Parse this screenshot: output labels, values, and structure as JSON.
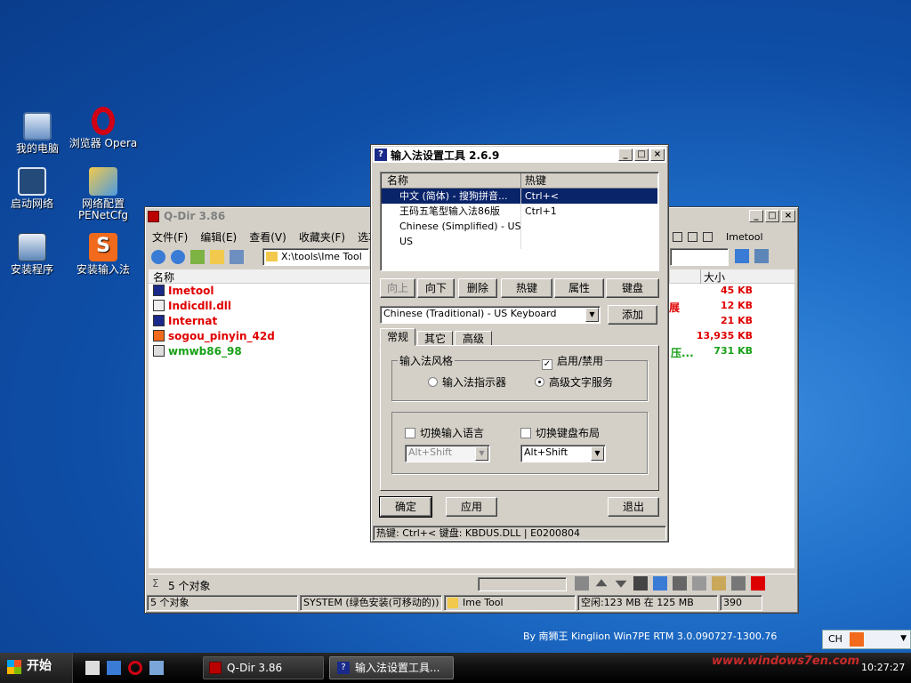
{
  "desktop": {
    "icons": [
      {
        "label": "我的电脑",
        "icon": "computer-icon"
      },
      {
        "label": "浏览器 Opera",
        "icon": "opera-icon"
      },
      {
        "label": "启动网络",
        "icon": "network-monitor-icon"
      },
      {
        "label": "网络配置",
        "sub": "PENetCfg",
        "icon": "network-config-icon"
      },
      {
        "label": "安装程序",
        "icon": "installer-icon"
      },
      {
        "label": "安装输入法",
        "icon": "sogou-icon"
      }
    ],
    "watermark": "By 南狮王 Kinglion Win7PE RTM 3.0.090727-1300.76"
  },
  "qdir": {
    "title": "Q-Dir 3.86",
    "menu": [
      "文件(F)",
      "编辑(E)",
      "查看(V)",
      "收藏夹(F)",
      "选项"
    ],
    "path": "X:\\tools\\Ime Tool",
    "right_label": "Imetool",
    "col_name": "名称",
    "col_size": "大小",
    "files": [
      {
        "name": "Imetool",
        "size": "45 KB",
        "color": "#e00000",
        "icon": "help-icon"
      },
      {
        "name": "Indicdll.dll",
        "size": "12 KB",
        "color": "#e00000",
        "icon": "dll-icon"
      },
      {
        "name": "Internat",
        "size": "21 KB",
        "color": "#e00000",
        "icon": "help-icon"
      },
      {
        "name": "sogou_pinyin_42d",
        "size": "13,935 KB",
        "color": "#e00000",
        "icon": "sogou-icon"
      },
      {
        "name": "wmwb86_98",
        "size": "731 KB",
        "color": "#17a017",
        "icon": "exe-icon"
      }
    ],
    "partial": [
      "展",
      "压..."
    ],
    "count_label": "5 个对象",
    "status": [
      "5 个对象",
      "SYSTEM (绿色安装(可移动的))",
      "Ime Tool",
      "空闲:123 MB 在 125 MB",
      "390"
    ]
  },
  "ime": {
    "title": "输入法设置工具 2.6.9",
    "col_name": "名称",
    "col_hotkey": "热键",
    "rows": [
      {
        "name": "中文 (简体) - 搜狗拼音...",
        "hotkey": "Ctrl+<",
        "selected": true
      },
      {
        "name": "王码五笔型输入法86版",
        "hotkey": "Ctrl+1",
        "selected": false
      },
      {
        "name": "Chinese (Simplified) - US...",
        "hotkey": "",
        "selected": false
      },
      {
        "name": "US",
        "hotkey": "",
        "selected": false
      }
    ],
    "buttons": [
      "向上",
      "向下",
      "删除",
      "热键",
      "属性",
      "键盘"
    ],
    "layout_select": "Chinese (Traditional) - US Keyboard",
    "add": "添加",
    "tabs": [
      "常规",
      "其它",
      "高级"
    ],
    "style_group": "输入法风格",
    "enable": "启用/禁用",
    "radio_indicator": "输入法指示器",
    "radio_advanced": "高级文字服务",
    "switch_lang": "切换输入语言",
    "switch_kbd": "切换键盘布局",
    "combo1": "Alt+Shift",
    "combo2": "Alt+Shift",
    "ok": "确定",
    "apply": "应用",
    "exit": "退出",
    "status": "热键: Ctrl+< 键盘: KBDUS.DLL | E0200804"
  },
  "taskbar": {
    "start": "开始",
    "tasks": [
      "Q-Dir 3.86",
      "输入法设置工具..."
    ],
    "lang": "CH",
    "time": "10:27:27",
    "brand": "www.windows7en.com"
  },
  "colors": {
    "selected": "#0a246a",
    "accent": "#1f6fc9"
  }
}
